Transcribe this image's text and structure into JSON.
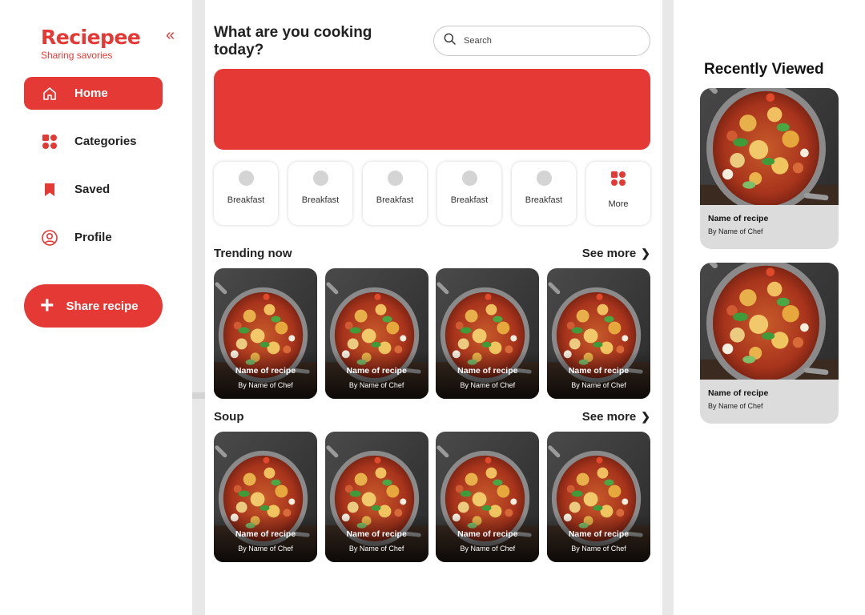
{
  "brand": {
    "name": "Reciepee",
    "tagline": "Sharing savories",
    "collapse_icon": "«"
  },
  "nav": [
    {
      "label": "Home",
      "icon": "home-icon",
      "active": true
    },
    {
      "label": "Categories",
      "icon": "grid-icon",
      "active": false
    },
    {
      "label": "Saved",
      "icon": "bookmark-icon",
      "active": false
    },
    {
      "label": "Profile",
      "icon": "user-icon",
      "active": false
    }
  ],
  "share_button": {
    "label": "Share recipe",
    "icon": "plus-icon"
  },
  "header": {
    "question": "What are you cooking today?"
  },
  "search": {
    "placeholder": "Search"
  },
  "categories": [
    {
      "label": "Breakfast"
    },
    {
      "label": "Breakfast"
    },
    {
      "label": "Breakfast"
    },
    {
      "label": "Breakfast"
    },
    {
      "label": "Breakfast"
    },
    {
      "label": "More"
    }
  ],
  "sections": [
    {
      "title": "Trending now",
      "see_more": "See more",
      "cards": [
        {
          "name": "Name of recipe",
          "chef": "By Name of Chef"
        },
        {
          "name": "Name of recipe",
          "chef": "By Name of Chef"
        },
        {
          "name": "Name of recipe",
          "chef": "By Name of Chef"
        },
        {
          "name": "Name of recipe",
          "chef": "By Name of Chef"
        }
      ]
    },
    {
      "title": "Soup",
      "see_more": "See more",
      "cards": [
        {
          "name": "Name of recipe",
          "chef": "By Name of Chef"
        },
        {
          "name": "Name of recipe",
          "chef": "By Name of Chef"
        },
        {
          "name": "Name of recipe",
          "chef": "By Name of Chef"
        },
        {
          "name": "Name of recipe",
          "chef": "By Name of Chef"
        }
      ]
    }
  ],
  "recently_viewed": {
    "title": "Recently Viewed",
    "cards": [
      {
        "name": "Name of recipe",
        "chef": "By Name of Chef"
      },
      {
        "name": "Name of recipe",
        "chef": "By Name of Chef"
      }
    ]
  },
  "colors": {
    "accent": "#e53935",
    "gutter": "#e8e8e8",
    "card_bg": "#dcdcdc"
  }
}
